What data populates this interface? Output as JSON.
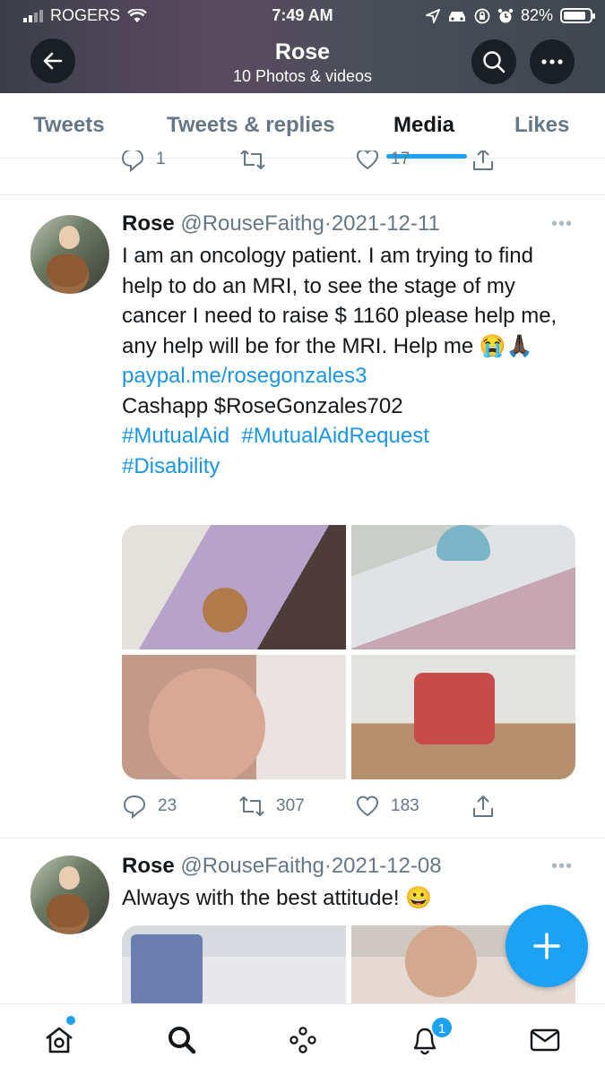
{
  "status_bar": {
    "carrier": "ROGERS",
    "time": "7:49 AM",
    "battery": "82%"
  },
  "header": {
    "profile_name": "Rose",
    "subtitle": "10 Photos & videos",
    "back_icon": "back-arrow-icon",
    "search_icon": "search-icon",
    "more_icon": "more-icon"
  },
  "tabs": [
    {
      "label": "Tweets"
    },
    {
      "label": "Tweets & replies"
    },
    {
      "label": "Media"
    },
    {
      "label": "Likes"
    }
  ],
  "previous_tweet": {
    "replies": "1",
    "likes": "17"
  },
  "tweets": [
    {
      "name": "Rose",
      "handle": "@RouseFaithg",
      "date": "2021-12-11",
      "text_line": "I am an oncology patient. I am trying to find help to do an MRI, to see the stage of my cancer I need to raise $ 1160 please help me, any help will be for the MRI. Help me 😭🙏🏿",
      "link": "paypal.me/rosegonzales3",
      "cashapp": "Cashapp $RoseGonzales702",
      "hashtag1": "#MutualAid",
      "hashtag2": "#MutualAidRequest",
      "hashtag3": "#Disability",
      "replies": "23",
      "retweets": "307",
      "likes": "183"
    },
    {
      "name": "Rose",
      "handle": "@RouseFaithg",
      "date": "2021-12-08",
      "text_line": "Always with the best attitude! 😀"
    }
  ],
  "bottom_nav": {
    "notifications_badge": "1",
    "icons": [
      "home-icon",
      "search-icon",
      "spaces-icon",
      "notifications-icon",
      "messages-icon"
    ]
  },
  "colors": {
    "accent": "#1da1f2",
    "link": "#1b95e0",
    "secondary_text": "#657786"
  }
}
